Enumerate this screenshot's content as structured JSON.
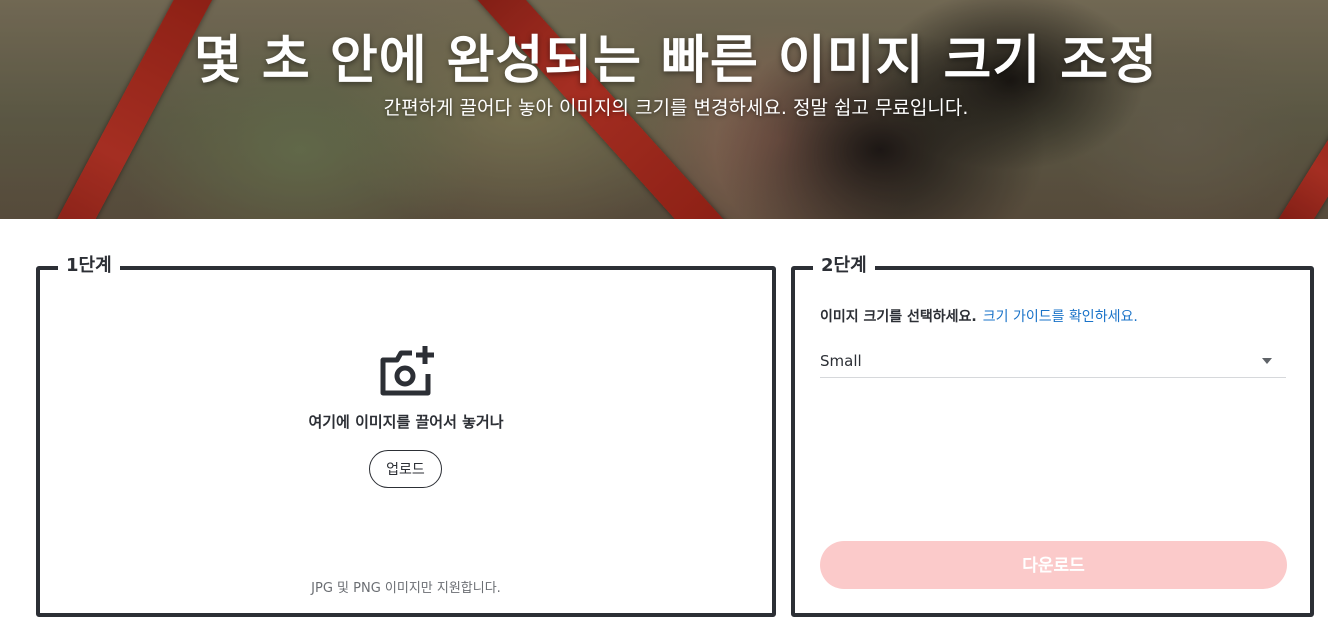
{
  "hero": {
    "title": "몇 초 안에 완성되는 빠른 이미지 크기 조정",
    "subtitle": "간편하게 끌어다 놓아 이미지의 크기를 변경하세요. 정말 쉽고 무료입니다."
  },
  "step1": {
    "legend": "1단계",
    "icon": "camera-plus-icon",
    "drop_text": "여기에 이미지를 끌어서 놓거나",
    "upload_label": "업로드",
    "support_note": "JPG 및 PNG 이미지만 지원합니다."
  },
  "step2": {
    "legend": "2단계",
    "size_prompt": "이미지 크기를 선택하세요.",
    "guide_link": "크기 가이드를 확인하세요.",
    "selected_size": "Small",
    "download_label": "다운로드"
  },
  "colors": {
    "border": "#2c2f35",
    "link": "#1a73c8",
    "download_disabled": "#fbcaca"
  }
}
